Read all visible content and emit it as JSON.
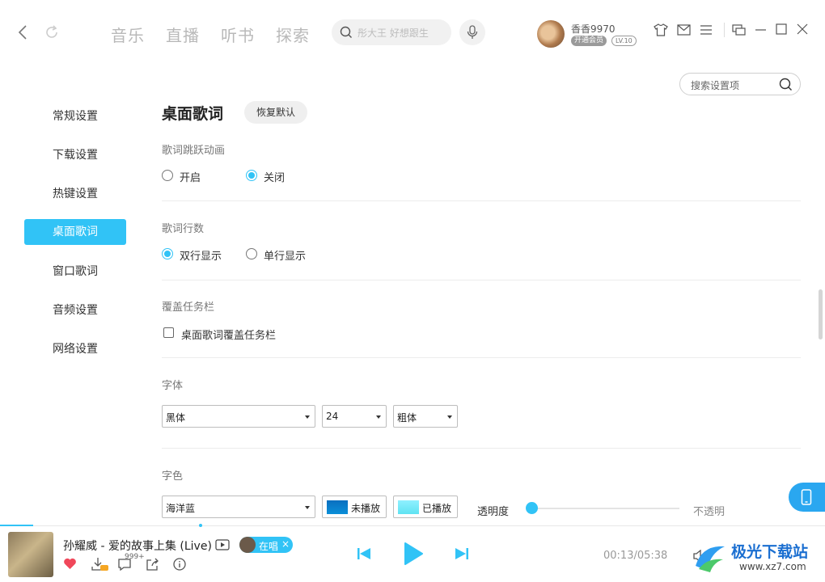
{
  "nav": {
    "tabs": [
      "音乐",
      "直播",
      "听书",
      "探索"
    ],
    "search_placeholder": "彤大王 好想跟生"
  },
  "user": {
    "name": "香香9970",
    "vip_label": "开通会员",
    "level": "LV.10"
  },
  "settings_search": {
    "placeholder": "搜索设置项"
  },
  "sidebar": {
    "items": [
      "常规设置",
      "下载设置",
      "热键设置",
      "桌面歌词",
      "窗口歌词",
      "音频设置",
      "网络设置"
    ],
    "active_index": 3
  },
  "main": {
    "title": "桌面歌词",
    "reset_label": "恢复默认",
    "sections": {
      "jump_animation": {
        "label": "歌词跳跃动画",
        "options": [
          "开启",
          "关闭"
        ],
        "selected": 1
      },
      "line_count": {
        "label": "歌词行数",
        "options": [
          "双行显示",
          "单行显示"
        ],
        "selected": 0
      },
      "taskbar": {
        "label": "覆盖任务栏",
        "checkbox_label": "桌面歌词覆盖任务栏",
        "checked": false
      },
      "font": {
        "label": "字体",
        "family": "黑体",
        "size": "24",
        "weight": "粗体"
      },
      "color": {
        "label": "字色",
        "scheme": "海洋蓝",
        "unplayed_label": "未播放",
        "played_label": "已播放",
        "unplayed_color": "#0a8fd8",
        "played_color": "#5fe3f2",
        "opacity_label": "透明度",
        "opacity_end_label": "不透明",
        "opacity_value": 0.0
      }
    }
  },
  "player": {
    "song": "孙耀威 - 爱的故事上集 (Live)",
    "singing_label": "在唱",
    "comment_count": "999+",
    "time_current": "00:13",
    "time_total": "05:38",
    "time_text": "00:13/05:38",
    "progress": 0.04
  },
  "watermark": {
    "title": "极光下载站",
    "url": "www.xz7.com"
  },
  "colors": {
    "accent": "#31c3f6",
    "heart": "#f0475a"
  }
}
